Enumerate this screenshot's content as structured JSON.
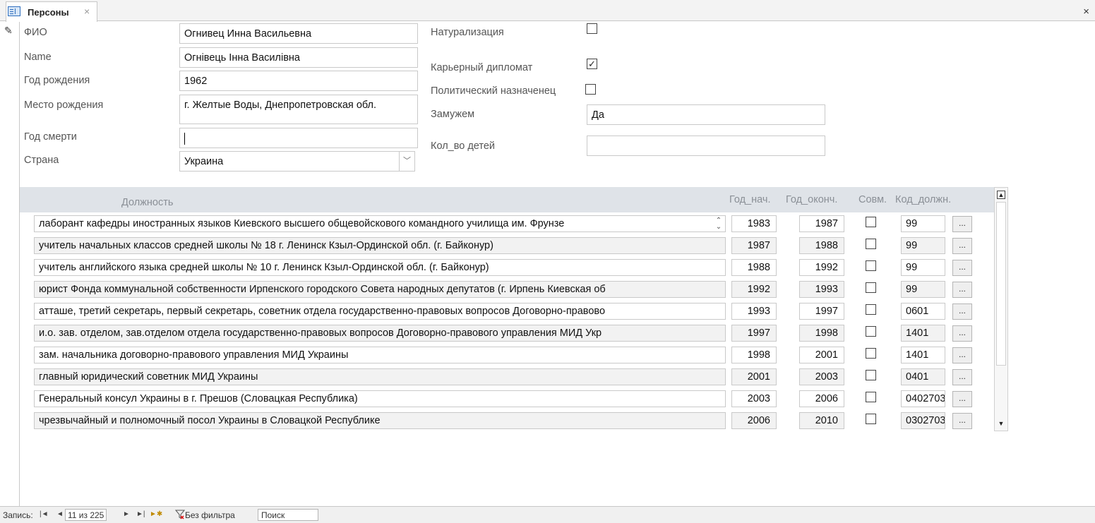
{
  "tab": {
    "title": "Персоны",
    "close": "×"
  },
  "window": {
    "close": "×"
  },
  "form": {
    "fio_label": "ФИО",
    "fio_value": "Огнивец Инна Васильевна",
    "name_label": "Name",
    "name_value": "Огнівець Інна Василівна",
    "birth_year_label": "Год рождения",
    "birth_year_value": "1962",
    "birth_place_label": "Место рождения",
    "birth_place_value": "г. Желтые Воды, Днепропетровская обл.",
    "death_year_label": "Год смерти",
    "death_year_value": "",
    "country_label": "Страна",
    "country_value": "Украина",
    "naturalization_label": "Натурализация",
    "naturalization_checked": false,
    "career_diplomat_label": "Карьерный дипломат",
    "career_diplomat_checked": true,
    "political_appointee_label": "Политический назначенец",
    "political_appointee_checked": false,
    "married_label": "Замужем",
    "married_value": "Да",
    "children_label": "Кол_во детей",
    "children_value": ""
  },
  "subform": {
    "headers": {
      "position": "Должность",
      "year_start": "Год_нач.",
      "year_end": "Год_оконч.",
      "combined": "Совм.",
      "position_code": "Код_должн."
    },
    "more_button_label": "...",
    "rows": [
      {
        "position": "лаборант кафедры иностранных языков Киевского высшего общевойскового командного училища им. Фрунзе",
        "year_start": "1983",
        "year_end": "1987",
        "combined": false,
        "code": "99"
      },
      {
        "position": "учитель начальных классов средней школы № 18 г. Ленинск Кзыл-Ординской обл. (г. Байконур)",
        "year_start": "1987",
        "year_end": "1988",
        "combined": false,
        "code": "99"
      },
      {
        "position": "учитель английского языка средней школы № 10 г. Ленинск Кзыл-Ординской обл. (г. Байконур)",
        "year_start": "1988",
        "year_end": "1992",
        "combined": false,
        "code": "99"
      },
      {
        "position": "юрист Фонда коммунальной собственности Ирпенского городского Совета народных депутатов (г. Ирпень Киевская об",
        "year_start": "1992",
        "year_end": "1993",
        "combined": false,
        "code": "99"
      },
      {
        "position": "атташе, третий секретарь, первый секретарь, советник отдела государственно-правовых вопросов Договорно-правово",
        "year_start": "1993",
        "year_end": "1997",
        "combined": false,
        "code": "0601"
      },
      {
        "position": "и.о. зав. отделом, зав.отделом отдела государственно-правовых вопросов Договорно-правового управления МИД Укр",
        "year_start": "1997",
        "year_end": "1998",
        "combined": false,
        "code": "1401"
      },
      {
        "position": "зам. начальника договорно-правового управления МИД Украины",
        "year_start": "1998",
        "year_end": "2001",
        "combined": false,
        "code": "1401"
      },
      {
        "position": "главный юридический советник МИД Украины",
        "year_start": "2001",
        "year_end": "2003",
        "combined": false,
        "code": "0401"
      },
      {
        "position": "Генеральный консул Украины в г. Прешов (Словацкая Республика)",
        "year_start": "2003",
        "year_end": "2006",
        "combined": false,
        "code": "0402703"
      },
      {
        "position": "чрезвычайный и полномочный посол Украины в Словацкой Республике",
        "year_start": "2006",
        "year_end": "2010",
        "combined": false,
        "code": "0302703"
      }
    ]
  },
  "navigation": {
    "record_label": "Запись:",
    "record_value": "11 из 225",
    "filter_label": "Без фильтра",
    "search_label": "Поиск"
  }
}
